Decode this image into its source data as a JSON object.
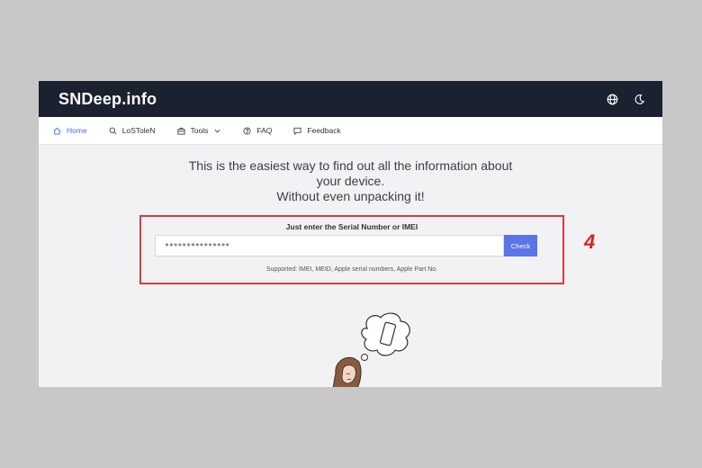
{
  "app": {
    "brand": "SNDeep.info",
    "icons": [
      "globe-icon",
      "moon-icon"
    ]
  },
  "nav": {
    "items": [
      {
        "label": "Home",
        "icon": "home-icon",
        "active": true
      },
      {
        "label": "LoSToleN",
        "icon": "search-icon",
        "active": false
      },
      {
        "label": "Tools",
        "icon": "toolbox-icon",
        "active": false,
        "dropdown": true
      },
      {
        "label": "FAQ",
        "icon": "help-circle-icon",
        "active": false
      },
      {
        "label": "Feedback",
        "icon": "comment-icon",
        "active": false
      }
    ]
  },
  "hero": {
    "line1": "This is the easiest way to find out all the information about",
    "line2": "your device.",
    "line3": "Without even unpacking it!"
  },
  "form": {
    "title": "Just enter the Serial Number or IMEI",
    "input_value": "***************",
    "button_label": "Check",
    "supported": "Supported: IMEI, MEID, Apple serial numbers, Apple Part No."
  },
  "annotation": {
    "number": "4",
    "color": "#d93a3a"
  },
  "colors": {
    "topbar": "#1c2130",
    "accent": "#4a6cf0",
    "button": "#5b74e8"
  }
}
